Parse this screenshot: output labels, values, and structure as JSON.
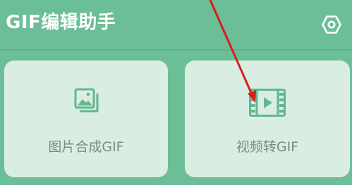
{
  "header": {
    "title": "GIF编辑助手",
    "settings_icon": "hexagon-gear-icon"
  },
  "cards": [
    {
      "label": "图片合成GIF",
      "icon": "image-stack-icon"
    },
    {
      "label": "视频转GIF",
      "icon": "video-film-icon"
    }
  ],
  "colors": {
    "background": "#6cbe98",
    "card_background": "#daede3",
    "icon": "#62b78f",
    "label_text": "#7c8a83",
    "title_text": "#ffffff",
    "annotation_arrow": "#d81e1e"
  }
}
